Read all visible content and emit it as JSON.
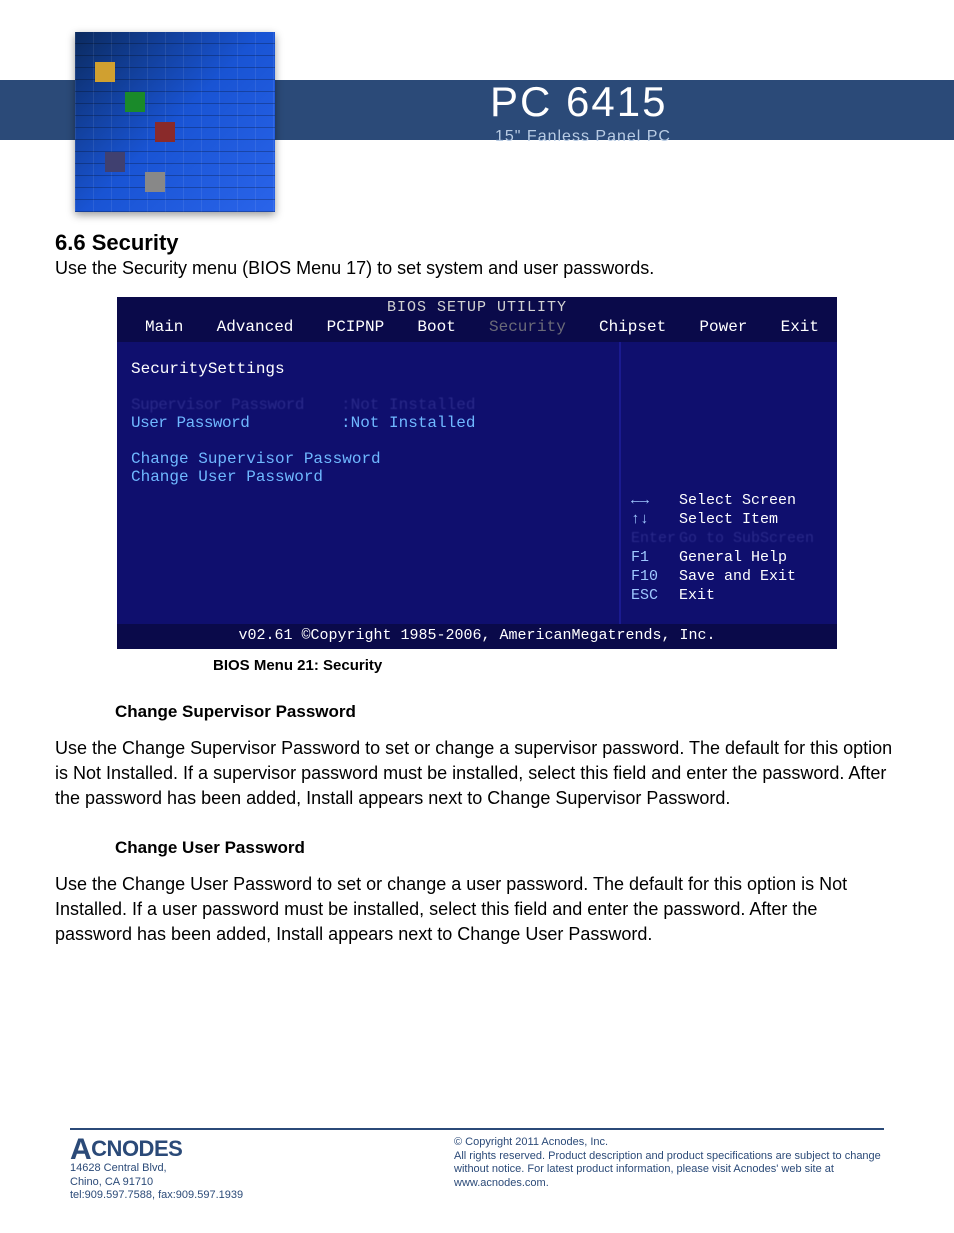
{
  "header": {
    "title": "PC 6415",
    "subtitle": "15\" Fanless Panel PC"
  },
  "section": {
    "number_title": "6.6  Security",
    "intro": "Use the Security menu (BIOS Menu 17) to set system and user passwords."
  },
  "bios": {
    "title": "BIOS SETUP UTILITY",
    "tabs": [
      "Main",
      "Advanced",
      "PCIPNP",
      "Boot",
      "Security",
      "Chipset",
      "Power",
      "Exit"
    ],
    "active_tab_index": 4,
    "left": {
      "heading": "SecuritySettings",
      "rows_muted": {
        "k": "Supervisor Password",
        "v": ":Not Installed"
      },
      "rows": [
        {
          "k": "User Password",
          "v": ":Not Installed"
        }
      ],
      "actions": [
        "Change Supervisor Password",
        "Change User Password"
      ]
    },
    "hints": [
      {
        "key": "←→",
        "txt": "Select Screen"
      },
      {
        "key": "↑↓",
        "txt": "Select Item"
      },
      {
        "key": "Enter",
        "txt": "Go to SubScreen",
        "muted": true
      },
      {
        "key": "F1",
        "txt": "General Help"
      },
      {
        "key": "F10",
        "txt": "Save and Exit"
      },
      {
        "key": "ESC",
        "txt": "Exit"
      }
    ],
    "footer": "v02.61 ©Copyright 1985-2006, AmericanMegatrends, Inc."
  },
  "caption": "BIOS Menu 21: Security",
  "blocks": [
    {
      "title": "Change Supervisor Password",
      "body": "Use the Change Supervisor Password to set or change a supervisor password. The default for this option is Not Installed. If a supervisor password must be installed, select this field and enter the password. After the password has been added, Install appears next to Change Supervisor Password."
    },
    {
      "title": "Change User Password",
      "body": "Use the Change User Password to set or change a user password. The default for this option is Not Installed. If a user password must be installed, select this field and enter the password. After the password has been added, Install appears next to Change User Password."
    }
  ],
  "footer": {
    "brand": "CNODES",
    "addr1": "14628 Central Blvd,",
    "addr2": "Chino, CA 91710",
    "addr3": "tel:909.597.7588, fax:909.597.1939",
    "copy1": "© Copyright 2011 Acnodes, Inc.",
    "copy2": "All rights reserved. Product description and product specifications are subject to change without notice. For latest product information, please visit Acnodes' web site at www.acnodes.com."
  }
}
